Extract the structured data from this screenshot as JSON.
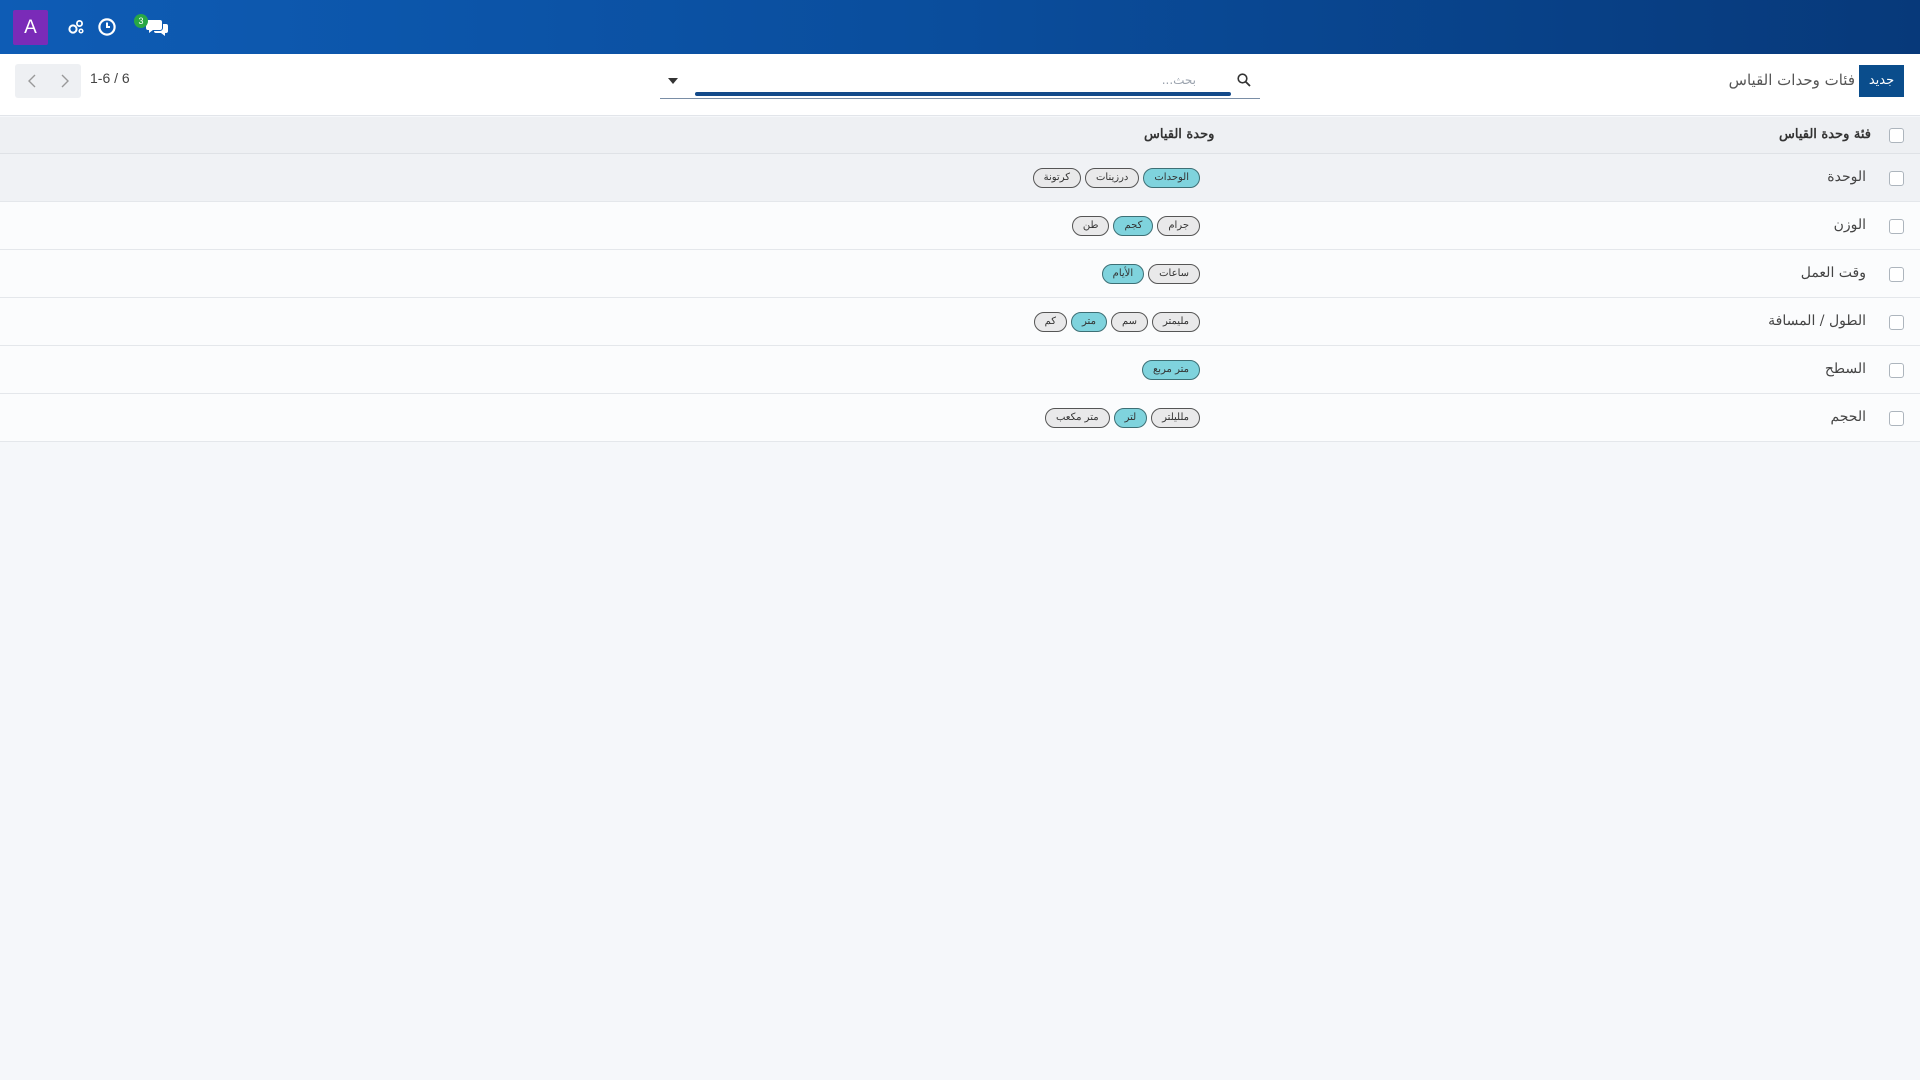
{
  "navbar": {
    "avatar_letter": "A",
    "activity_badge": "3",
    "icons": [
      "debug-icon",
      "clock-icon",
      "chat-icon"
    ]
  },
  "control": {
    "new_button": "جديد",
    "title": "فئات وحدات القياس",
    "search_placeholder": "بحث...",
    "pager_value": "1-6 / 6"
  },
  "list": {
    "header": {
      "name": "فئة وحدة القياس",
      "uoms": "وحدة القياس"
    },
    "rows": [
      {
        "name": "الوحدة",
        "tags": [
          {
            "label": "الوحدات",
            "ref": true
          },
          {
            "label": "درزينات",
            "ref": false
          },
          {
            "label": "كرتونة",
            "ref": false
          }
        ]
      },
      {
        "name": "الوزن",
        "tags": [
          {
            "label": "جرام",
            "ref": false
          },
          {
            "label": "كجم",
            "ref": true
          },
          {
            "label": "طن",
            "ref": false
          }
        ]
      },
      {
        "name": "وقت العمل",
        "tags": [
          {
            "label": "ساعات",
            "ref": false
          },
          {
            "label": "الأيام",
            "ref": true
          }
        ]
      },
      {
        "name": "الطول / المسافة",
        "tags": [
          {
            "label": "مليمتر",
            "ref": false
          },
          {
            "label": "سم",
            "ref": false
          },
          {
            "label": "متر",
            "ref": true
          },
          {
            "label": "كم",
            "ref": false
          }
        ]
      },
      {
        "name": "السطح",
        "tags": [
          {
            "label": "متر مربع",
            "ref": true
          }
        ]
      },
      {
        "name": "الحجم",
        "tags": [
          {
            "label": "ملليلتر",
            "ref": false
          },
          {
            "label": "لتر",
            "ref": true
          },
          {
            "label": "متر مكعب",
            "ref": false
          }
        ]
      }
    ]
  },
  "colors": {
    "navbar": "#0a4d9c",
    "avatar": "#7a2bb8",
    "new_button": "#0a4d8c",
    "reference_tag": "#7fd3dd",
    "badge": "#28a745"
  }
}
